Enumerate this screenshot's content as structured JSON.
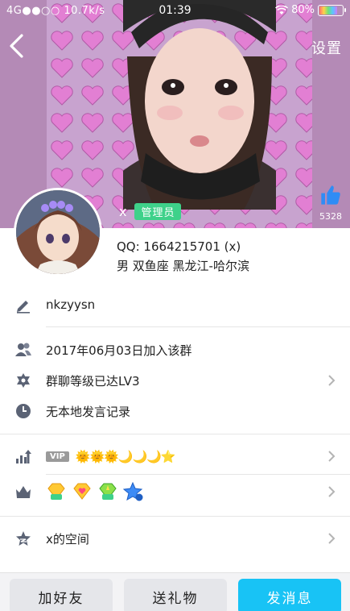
{
  "status_bar": {
    "network": "4G●●○○ 10.7k/s",
    "time": "01:39",
    "battery": "80%",
    "battery_level": 0.8
  },
  "header": {
    "settings_label": "设置",
    "like_count": "5328",
    "nickname": "x",
    "admin_badge": "管理员"
  },
  "profile": {
    "qq": "QQ: 1664215701 (x)",
    "details": "男  双鱼座  黑龙江-哈尔滨"
  },
  "rows": {
    "signature": "nkzyysn",
    "join_date": "2017年06月03日加入该群",
    "group_level": "群聊等级已达LV3",
    "chat_record": "无本地发言记录",
    "vip_tag": "VIP",
    "level_icons": "🌞🌞🌞🌙🌙🌙⭐",
    "space": "x的空间"
  },
  "colors": {
    "accent": "#18c3f5",
    "admin_green": "#3ed18a",
    "icon_gray": "#5b6375"
  },
  "bottom": {
    "add_friend": "加好友",
    "send_gift": "送礼物",
    "send_message": "发消息"
  }
}
